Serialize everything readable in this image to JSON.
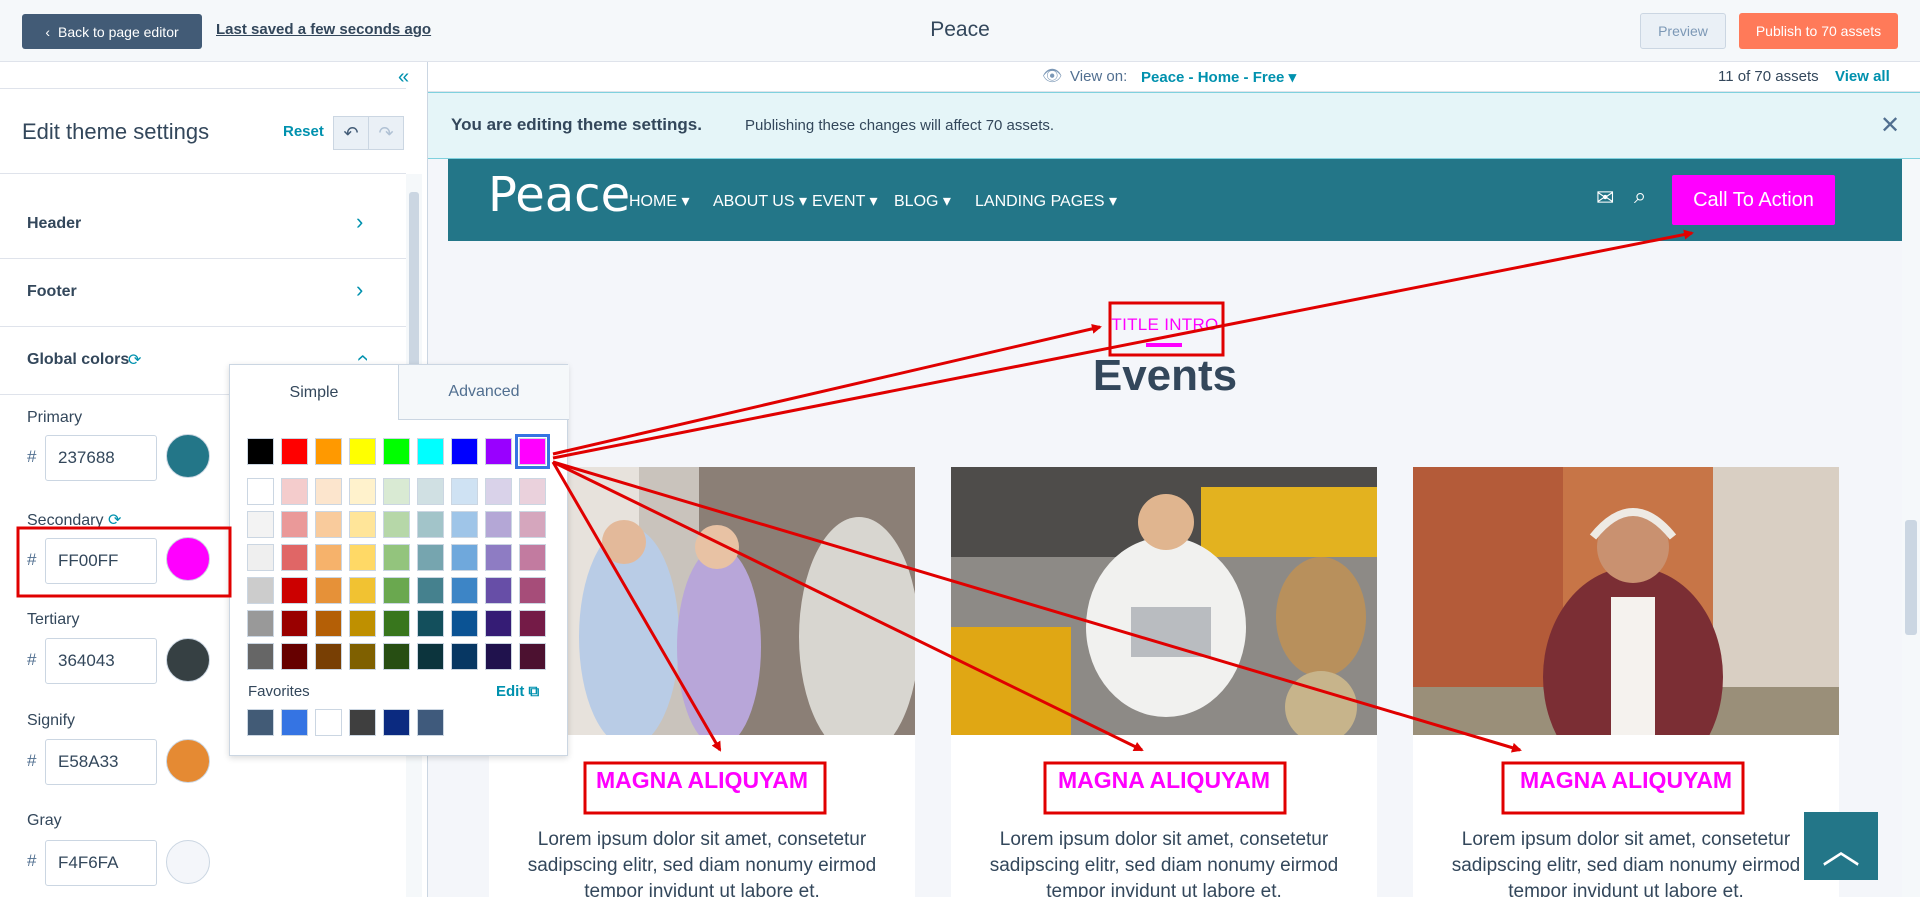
{
  "topbar": {
    "back_label": "Back to page editor",
    "saved_label": "Last saved a few seconds ago",
    "page_title": "Peace",
    "preview_label": "Preview",
    "publish_label": "Publish to 70 assets"
  },
  "sidebar": {
    "title": "Edit theme settings",
    "reset_label": "Reset",
    "sections": {
      "header": "Header",
      "footer": "Footer",
      "global_colors": "Global colors"
    },
    "colors": [
      {
        "label": "Primary",
        "hex": "237688",
        "color": "#237688"
      },
      {
        "label": "Secondary",
        "hex": "FF00FF",
        "color": "#FF00FF"
      },
      {
        "label": "Tertiary",
        "hex": "364043",
        "color": "#364043"
      },
      {
        "label": "Signify",
        "hex": "E58A33",
        "color": "#E58A33"
      },
      {
        "label": "Gray",
        "hex": "F4F6FA",
        "color": "#F4F6FA"
      }
    ],
    "hash": "#"
  },
  "viewbar": {
    "view_on_label": "View on:",
    "view_on_value": "Peace - Home - Free",
    "assets_count": "11 of 70 assets",
    "view_all_label": "View all"
  },
  "banner": {
    "bold": "You are editing theme settings.",
    "text": "Publishing these changes will affect 70 assets."
  },
  "site": {
    "logo": "Peace",
    "menu": [
      "HOME",
      "ABOUT US",
      "EVENT",
      "BLOG",
      "LANDING PAGES"
    ],
    "cta": "Call To Action",
    "title_intro": "TITLE INTRO",
    "events_heading": "Events",
    "cards": [
      {
        "title": "MAGNA ALIQUYAM",
        "text": "Lorem ipsum dolor sit amet, consetetur sadipscing elitr, sed diam nonumy eirmod tempor invidunt ut labore et."
      },
      {
        "title": "MAGNA ALIQUYAM",
        "text": "Lorem ipsum dolor sit amet, consetetur sadipscing elitr, sed diam nonumy eirmod tempor invidunt ut labore et."
      },
      {
        "title": "MAGNA ALIQUYAM",
        "text": "Lorem ipsum dolor sit amet, consetetur sadipscing elitr, sed diam nonumy eirmod tempor invidunt ut labore et."
      }
    ]
  },
  "picker": {
    "tab_simple": "Simple",
    "tab_advanced": "Advanced",
    "favorites_label": "Favorites",
    "edit_label": "Edit",
    "grid": [
      [
        "#000000",
        "#ff0000",
        "#ff9900",
        "#ffff00",
        "#00ff00",
        "#00ffff",
        "#0000ff",
        "#9900ff",
        "#ff00ff"
      ],
      [
        "#ffffff",
        "#f4cccc",
        "#fce5cd",
        "#fff2cc",
        "#d9ead3",
        "#d0e0e3",
        "#cfe2f3",
        "#d9d2e9",
        "#ead1dc"
      ],
      [
        "#f3f3f3",
        "#ea9999",
        "#f9cb9c",
        "#ffe599",
        "#b6d7a8",
        "#a2c4c9",
        "#9fc5e8",
        "#b4a7d6",
        "#d5a6bd"
      ],
      [
        "#efefef",
        "#e06666",
        "#f6b26b",
        "#ffd966",
        "#93c47d",
        "#76a5af",
        "#6fa8dc",
        "#8e7cc3",
        "#c27ba0"
      ],
      [
        "#cccccc",
        "#cc0000",
        "#e69138",
        "#f1c232",
        "#6aa84f",
        "#45818e",
        "#3d85c6",
        "#674ea7",
        "#a64d79"
      ],
      [
        "#999999",
        "#990000",
        "#b45f06",
        "#bf9000",
        "#38761d",
        "#134f5c",
        "#0b5394",
        "#351c75",
        "#741b47"
      ],
      [
        "#666666",
        "#660000",
        "#783f04",
        "#7f6000",
        "#274e13",
        "#0c343d",
        "#073763",
        "#20124d",
        "#4c1130"
      ]
    ],
    "favorites": [
      "#425b76",
      "#3574e3",
      "#ffffff",
      "#3f3f3f",
      "#0b2a80",
      "#3f5a7c"
    ],
    "selected_color": "#ff00ff"
  },
  "annotation_color": "#e00000",
  "icons": [
    "chevron-left-icon",
    "double-chevron-left-icon",
    "undo-icon",
    "redo-icon",
    "chevron-right-icon",
    "chevron-up-icon",
    "refresh-icon",
    "eye-icon",
    "caret-down-icon",
    "close-icon",
    "mail-icon",
    "search-icon",
    "external-link-icon",
    "arrow-up-icon"
  ]
}
